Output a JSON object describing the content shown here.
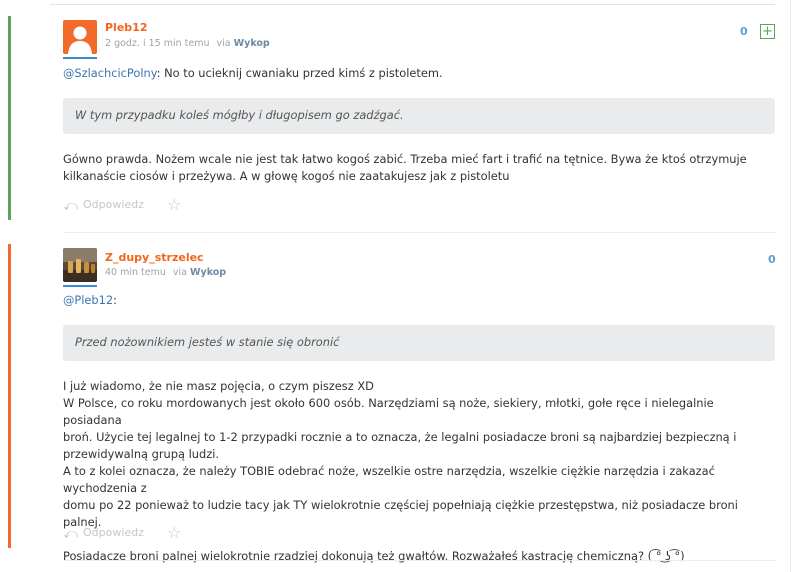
{
  "comments": [
    {
      "username": "Pleb12",
      "time": "2 godz. i 15 min temu",
      "via_prefix": "via",
      "via_app": "Wykop",
      "score": "0",
      "plus_symbol": "+",
      "mention": "@SzlachcicPolny",
      "first_line": ": No to ucieknij cwaniaku przed kimś z pistoletem.",
      "quote": "W tym przypadku koleś mógłby i długopisem go zadźgać.",
      "body_lines": [
        "Gówno prawda. Nożem wcale nie jest tak łatwo kogoś zabić. Trzeba mieć fart i trafić na tętnice. Bywa że ktoś otrzymuje",
        "kilkanaście ciosów i przeżywa. A w głowę kogoś nie zaatakujesz jak z pistoletu"
      ],
      "reply_label": "Odpowiedz",
      "accent": "#58a65a"
    },
    {
      "username": "Z_dupy_strzelec",
      "time": "40 min temu",
      "via_prefix": "via",
      "via_app": "Wykop",
      "score": "0",
      "mention": "@Pleb12",
      "first_line": ":",
      "quote": "Przed nożownikiem jesteś w stanie się obronić",
      "body_lines": [
        "I już wiadomo, że nie masz pojęcia, o czym piszesz XD",
        "W Polsce, co roku mordowanych jest około 600 osób. Narzędziami są noże, siekiery, młotki, gołe ręce i nielegalnie posiadana",
        "broń. Użycie tej legalnej to 1-2 przypadki rocznie a to oznacza, że legalni posiadacze broni są najbardziej bezpieczną i",
        "przewidywalną grupą ludzi.",
        "A to z kolei oznacza, że należy TOBIE odebrać noże, wszelkie ostre narzędzia, wszelkie ciężkie narzędzia i zakazać wychodzenia z",
        "domu po 22 ponieważ to ludzie tacy jak TY wielokrotnie częściej popełniają ciężkie przestępstwa, niż posiadacze broni palnej.",
        "",
        "Posiadacze broni palnej wielokrotnie rzadziej dokonują też gwałtów. Rozważałeś kastrację chemiczną? ( ͡° ͜ʖ ͡°)"
      ],
      "reply_label": "Odpowiedz",
      "accent": "#f26b2a"
    }
  ],
  "icons": {
    "reply": "reply-icon",
    "star": "star-icon",
    "plus": "plus-icon",
    "avatar_default": "default-avatar-icon"
  }
}
